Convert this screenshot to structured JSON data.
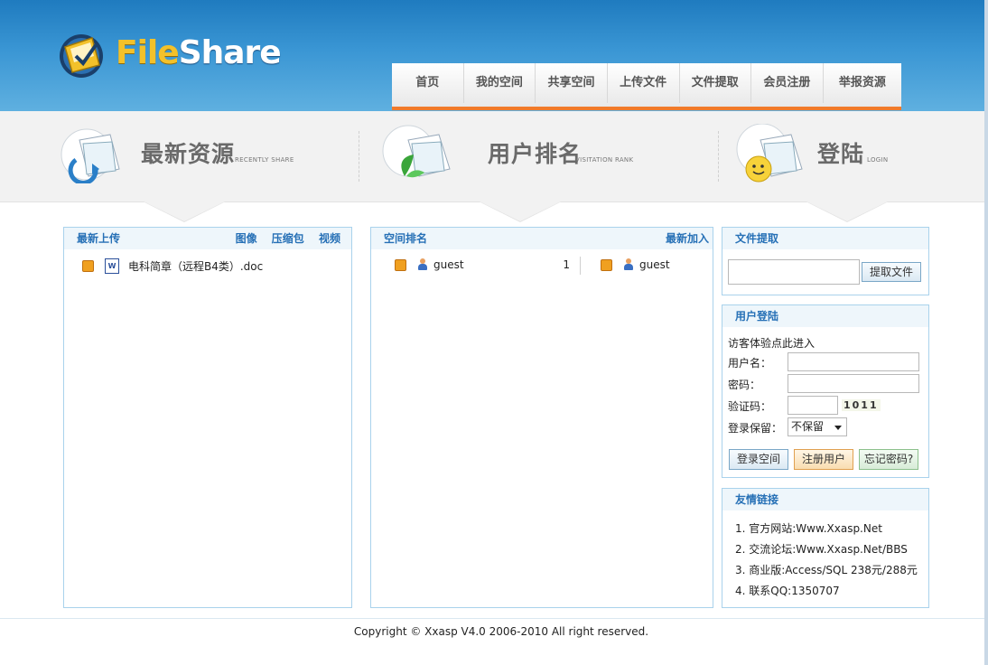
{
  "logo": {
    "part1": "File",
    "part2": "Share"
  },
  "nav": [
    "首页",
    "我的空间",
    "共享空间",
    "上传文件",
    "文件提取",
    "会员注册",
    "举报资源"
  ],
  "band": [
    {
      "title": "最新资源",
      "sub": "RECENTLY SHARE"
    },
    {
      "title": "用户排名",
      "sub": "VISITATION RANK"
    },
    {
      "title": "登陆",
      "sub": "LOGIN"
    }
  ],
  "latest": {
    "title": "最新上传",
    "filters": [
      "图像",
      "压缩包",
      "视频"
    ],
    "items": [
      {
        "name": "电科简章（远程B4类）.doc"
      }
    ]
  },
  "rank": {
    "title": "空间排名",
    "right": "最新加入",
    "ranked": [
      {
        "user": "guest",
        "count": "1"
      }
    ],
    "newest": [
      {
        "user": "guest"
      }
    ]
  },
  "extract": {
    "title": "文件提取",
    "input_value": "",
    "button": "提取文件"
  },
  "login": {
    "title": "用户登陆",
    "guest_tip": "访客体验点此进入",
    "username_label": "用户名：",
    "password_label": "密码：",
    "captcha_label": "验证码：",
    "captcha_value": "1011",
    "keep_label": "登录保留：",
    "keep_value": "不保留",
    "btn_login": "登录空间",
    "btn_register": "注册用户",
    "btn_forgot": "忘记密码?"
  },
  "links": {
    "title": "友情链接",
    "items": [
      "1. 官方网站:Www.Xxasp.Net",
      "2. 交流论坛:Www.Xxasp.Net/BBS",
      "3. 商业版:Access/SQL 238元/288元",
      "4. 联系QQ:1350707"
    ]
  },
  "footer": "Copyright © Xxasp V4.0 2006-2010 All right reserved.",
  "colors": {
    "header": "#3a96d4",
    "accent": "#f07a2a",
    "panel_border": "#a9d2ec",
    "link": "#2670b6"
  }
}
